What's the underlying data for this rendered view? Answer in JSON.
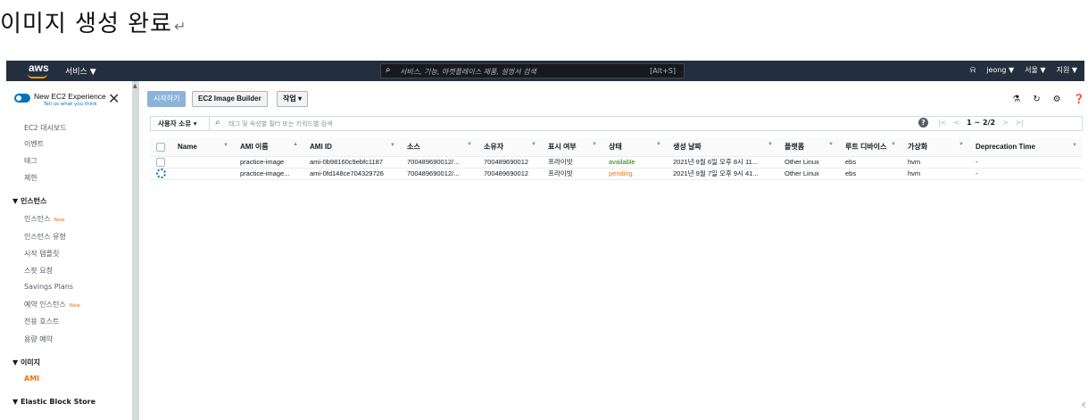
{
  "doc": {
    "heading": "이미지 생성 완료",
    "return_mark": "↵"
  },
  "topbar": {
    "logo": "aws",
    "services": "서비스 ▼",
    "search_placeholder": "서비스, 기능, 마켓플레이스 제품, 설명서 검색",
    "search_shortcut": "[Alt+S]",
    "user": "jeong ▼",
    "region": "서울 ▼",
    "support": "지원 ▼"
  },
  "sidebar": {
    "new_experience": "New EC2 Experience",
    "tell_us": "Tell us what you think",
    "items_top": [
      "EC2 대시보드",
      "이벤트",
      "태그",
      "제한"
    ],
    "section_instances": "▼ 인스턴스",
    "instances_items": [
      {
        "label": "인스턴스",
        "badge": "New"
      },
      {
        "label": "인스턴스 유형",
        "badge": ""
      },
      {
        "label": "시작 템플릿",
        "badge": ""
      },
      {
        "label": "스팟 요청",
        "badge": ""
      },
      {
        "label": "Savings Plans",
        "badge": ""
      },
      {
        "label": "예약 인스턴스",
        "badge": "New"
      },
      {
        "label": "전용 호스트",
        "badge": ""
      },
      {
        "label": "용량 예약",
        "badge": ""
      }
    ],
    "section_images": "▼ 이미지",
    "ami": "AMI",
    "section_ebs": "▼ Elastic Block Store"
  },
  "toolbar": {
    "launch": "시작하기",
    "image_builder": "EC2 Image Builder",
    "actions": "작업 ▾"
  },
  "filter": {
    "owner": "사용자 소유 ▾",
    "placeholder": "태그 및 속성별 필터 또는 키워드별 검색",
    "pager": "1 ~ 2/2"
  },
  "table": {
    "headers": [
      "Name",
      "AMI 이름",
      "AMI ID",
      "소스",
      "소유자",
      "표시 여부",
      "상태",
      "생성 날짜",
      "플랫폼",
      "루트 디바이스",
      "가상화",
      "Deprecation Time"
    ],
    "rows": [
      {
        "name": "",
        "ami_name": "practice-image",
        "ami_id": "ami-0b98160c9ebfc1187",
        "source": "700489690012/...",
        "owner": "700489690012",
        "visibility": "프라이빗",
        "status": "available",
        "created": "2021년 9월 6일 오후 8시 11...",
        "platform": "Other Linux",
        "root": "ebs",
        "virt": "hvm",
        "deprecation": "-"
      },
      {
        "name": "",
        "ami_name": "practice-image...",
        "ami_id": "ami-0fd148ce704329726",
        "source": "700489690012/...",
        "owner": "700489690012",
        "visibility": "프라이빗",
        "status": "pending",
        "created": "2021년 9월 7일 오후 9시 41...",
        "platform": "Other Linux",
        "root": "ebs",
        "virt": "hvm",
        "deprecation": "-"
      }
    ]
  },
  "colors": {
    "nav_bg": "#232f3e",
    "accent": "#ec7211",
    "available": "#1d8102",
    "pending": "#ec7211",
    "primary": "#0073bb"
  }
}
